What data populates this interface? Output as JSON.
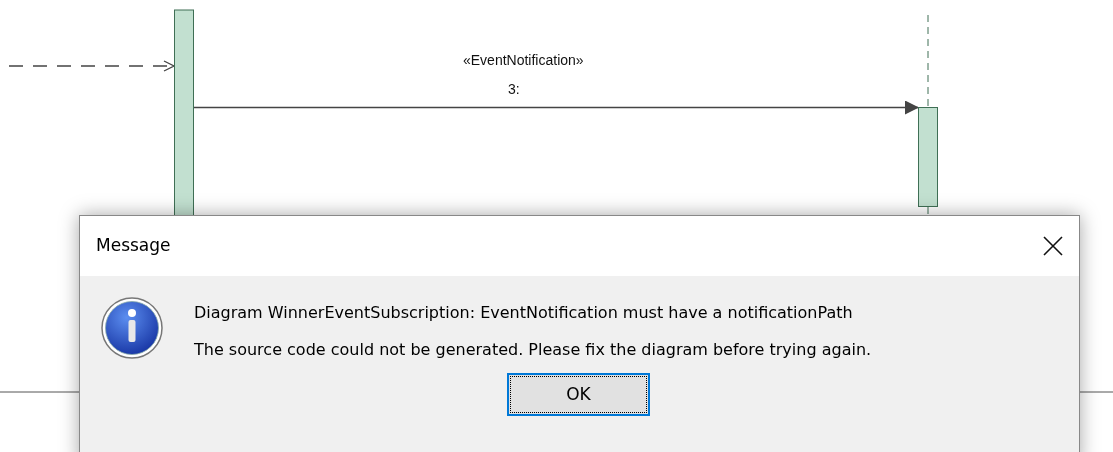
{
  "diagram": {
    "message": {
      "stereotype": "«EventNotification»",
      "sequence": "3:"
    }
  },
  "dialog": {
    "title": "Message",
    "lines": [
      "Diagram WinnerEventSubscription: EventNotification must have a notificationPath",
      "The source code could not be generated. Please fix the diagram before trying again."
    ],
    "button": {
      "label": "OK",
      "focused": true
    }
  }
}
